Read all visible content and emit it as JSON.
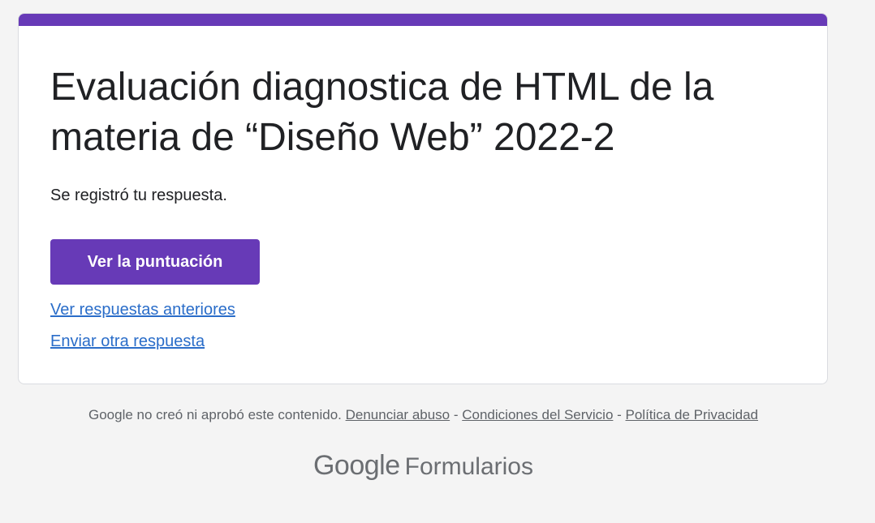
{
  "theme": {
    "accent_color": "#673ab7",
    "page_background": "#f4f4f4",
    "link_color": "#2a6dc9"
  },
  "form": {
    "title": "Evaluación diagnostica de HTML de la materia de “Diseño Web” 2022-2",
    "confirmation_message": "Se registró tu respuesta.",
    "view_score_label": "Ver la puntuación",
    "view_previous_responses_label": "Ver respuestas anteriores",
    "submit_another_label": "Enviar otra respuesta"
  },
  "footer": {
    "disclaimer": "Google no creó ni aprobó este contenido.",
    "separator": " - ",
    "report_abuse_label": "Denunciar abuso",
    "terms_label": "Condiciones del Servicio",
    "privacy_label": "Política de Privacidad"
  },
  "brand": {
    "company": "Google",
    "product": "Formularios"
  }
}
